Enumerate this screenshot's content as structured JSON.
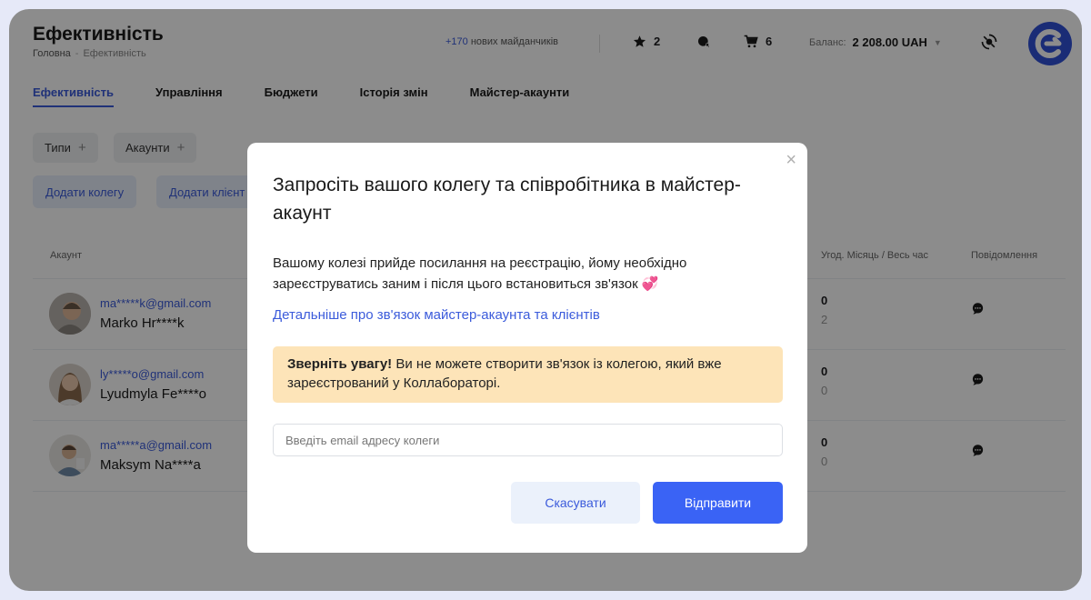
{
  "header": {
    "title": "Ефективність",
    "breadcrumb": {
      "home": "Головна",
      "separator": "-",
      "current": "Ефективність"
    },
    "new_sites": {
      "count": "+170",
      "text": "нових майданчиків"
    },
    "favorites_count": "2",
    "cart_count": "6",
    "balance_label": "Баланс:",
    "balance_amount": "2 208.00 UAH",
    "accent_color": "#3b5bdb"
  },
  "tabs": [
    {
      "label": "Ефективність",
      "active": true
    },
    {
      "label": "Управління"
    },
    {
      "label": "Бюджети"
    },
    {
      "label": "Історія змін"
    },
    {
      "label": "Майстер-акаунти"
    }
  ],
  "filters": {
    "types": "Типи",
    "accounts": "Акаунти"
  },
  "actions": {
    "add_colleague": "Додати колегу",
    "add_client": "Додати клієнт"
  },
  "table": {
    "headers": {
      "account": "Акаунт",
      "deals": "Угод. Місяць / Весь час",
      "messages": "Повідомлення"
    },
    "rows": [
      {
        "email": "ma*****k@gmail.com",
        "name": "Marko Hr****k",
        "deals_month": "0",
        "deals_all": "2"
      },
      {
        "email": "ly*****o@gmail.com",
        "name": "Lyudmyla Fe****o",
        "deals_month": "0",
        "deals_all": "0"
      },
      {
        "email": "ma*****a@gmail.com",
        "name": "Maksym Na****a",
        "deals_month": "0",
        "deals_all": "0"
      }
    ]
  },
  "modal": {
    "close": "×",
    "title": "Запросіть вашого колегу та співробітника в майстер-акаунт",
    "text": "Вашому колезі прийде посилання на реєстрацію, йому необхідно зареєструватись заним і після цього встановиться зв'язок 💞",
    "link": "Детальніше про зв'язок майстер-акаунта та клієнтів",
    "warning_bold": "Зверніть увагу!",
    "warning_text": " Ви не можете створити зв'язок із колегою, який вже зареєстрований у Коллабораторі.",
    "email_placeholder": "Введіть email адресу колеги",
    "cancel": "Скасувати",
    "submit": "Відправити"
  }
}
